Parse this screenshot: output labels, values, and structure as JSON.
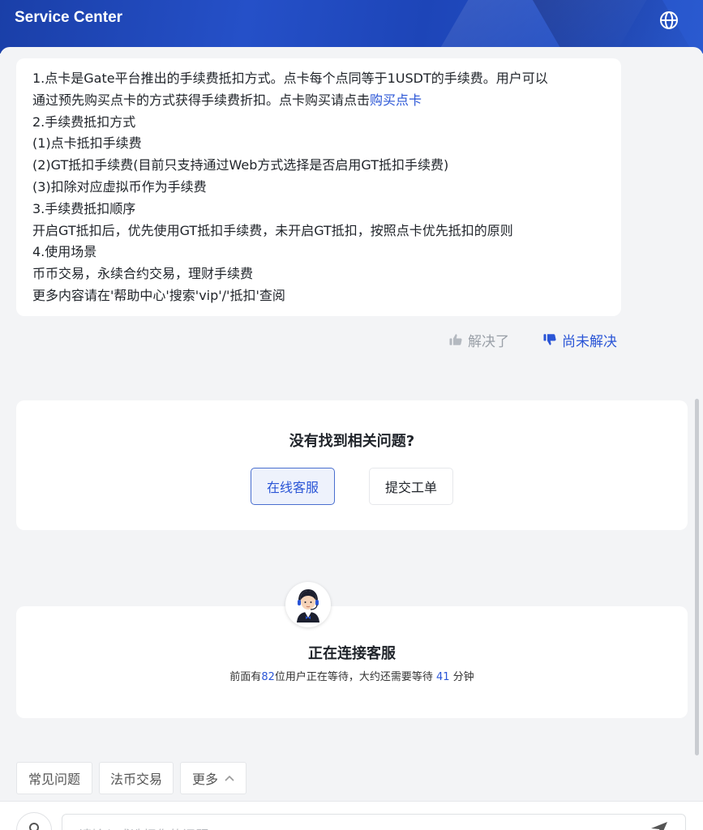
{
  "header": {
    "title": "Service Center",
    "globe_icon": "globe-icon"
  },
  "answer": {
    "lines": [
      "1.点卡是Gate平台推出的手续费抵扣方式。点卡每个点同等于1USDT的手续费。用户可以",
      "通过预先购买点卡的方式获得手续费折扣。点卡购买请点击",
      "2.手续费抵扣方式",
      "(1)点卡抵扣手续费",
      "(2)GT抵扣手续费(目前只支持通过Web方式选择是否启用GT抵扣手续费)",
      "(3)扣除对应虚拟币作为手续费",
      "3.手续费抵扣顺序",
      "开启GT抵扣后，优先使用GT抵扣手续费，未开启GT抵扣，按照点卡优先抵扣的原则",
      "4.使用场景",
      "币币交易，永续合约交易，理财手续费",
      "更多内容请在'帮助中心'搜索'vip'/'抵扣'查阅"
    ],
    "link_text": "购买点卡"
  },
  "feedback": {
    "solved": "解决了",
    "unsolved": "尚未解决"
  },
  "nofound": {
    "question": "没有找到相关问题?",
    "online_btn": "在线客服",
    "ticket_btn": "提交工单"
  },
  "connecting": {
    "title": "正在连接客服",
    "wait_prefix": "前面有",
    "queue_count": "82",
    "wait_middle": "位用户正在等待，大约还需要等待 ",
    "wait_minutes": "41",
    "wait_suffix": " 分钟"
  },
  "quick_chips": {
    "faq": "常见问题",
    "fiat": "法币交易",
    "more": "更多"
  },
  "input": {
    "placeholder": "请输入或选择您的问题"
  },
  "colors": {
    "brand_blue": "#2a55d6",
    "header_blue": "#1d45b8",
    "background": "#f3f4f6"
  }
}
